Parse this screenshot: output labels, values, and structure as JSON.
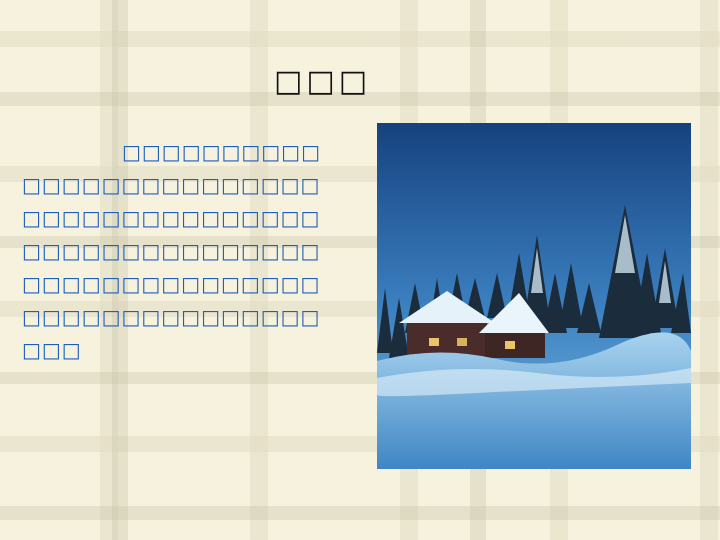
{
  "slide": {
    "title": "□□□",
    "body": "□□□□□□□□□□□□□□□□□□□□□□□□□□□□□□□□□□□□□□□□□□□□□□□□□□□□□□□□□□□□□□□□□□□□□□□□□□□□□□□□□□□□□□□□",
    "picture": {
      "subject": "snowy-cabin-night-photo",
      "colors": {
        "sky_top": "#19488f",
        "sky_bottom": "#5fa6d6",
        "snow": "#cfe6f5",
        "trees": "#1b2c3d",
        "house": "#4a2c2a"
      }
    }
  }
}
